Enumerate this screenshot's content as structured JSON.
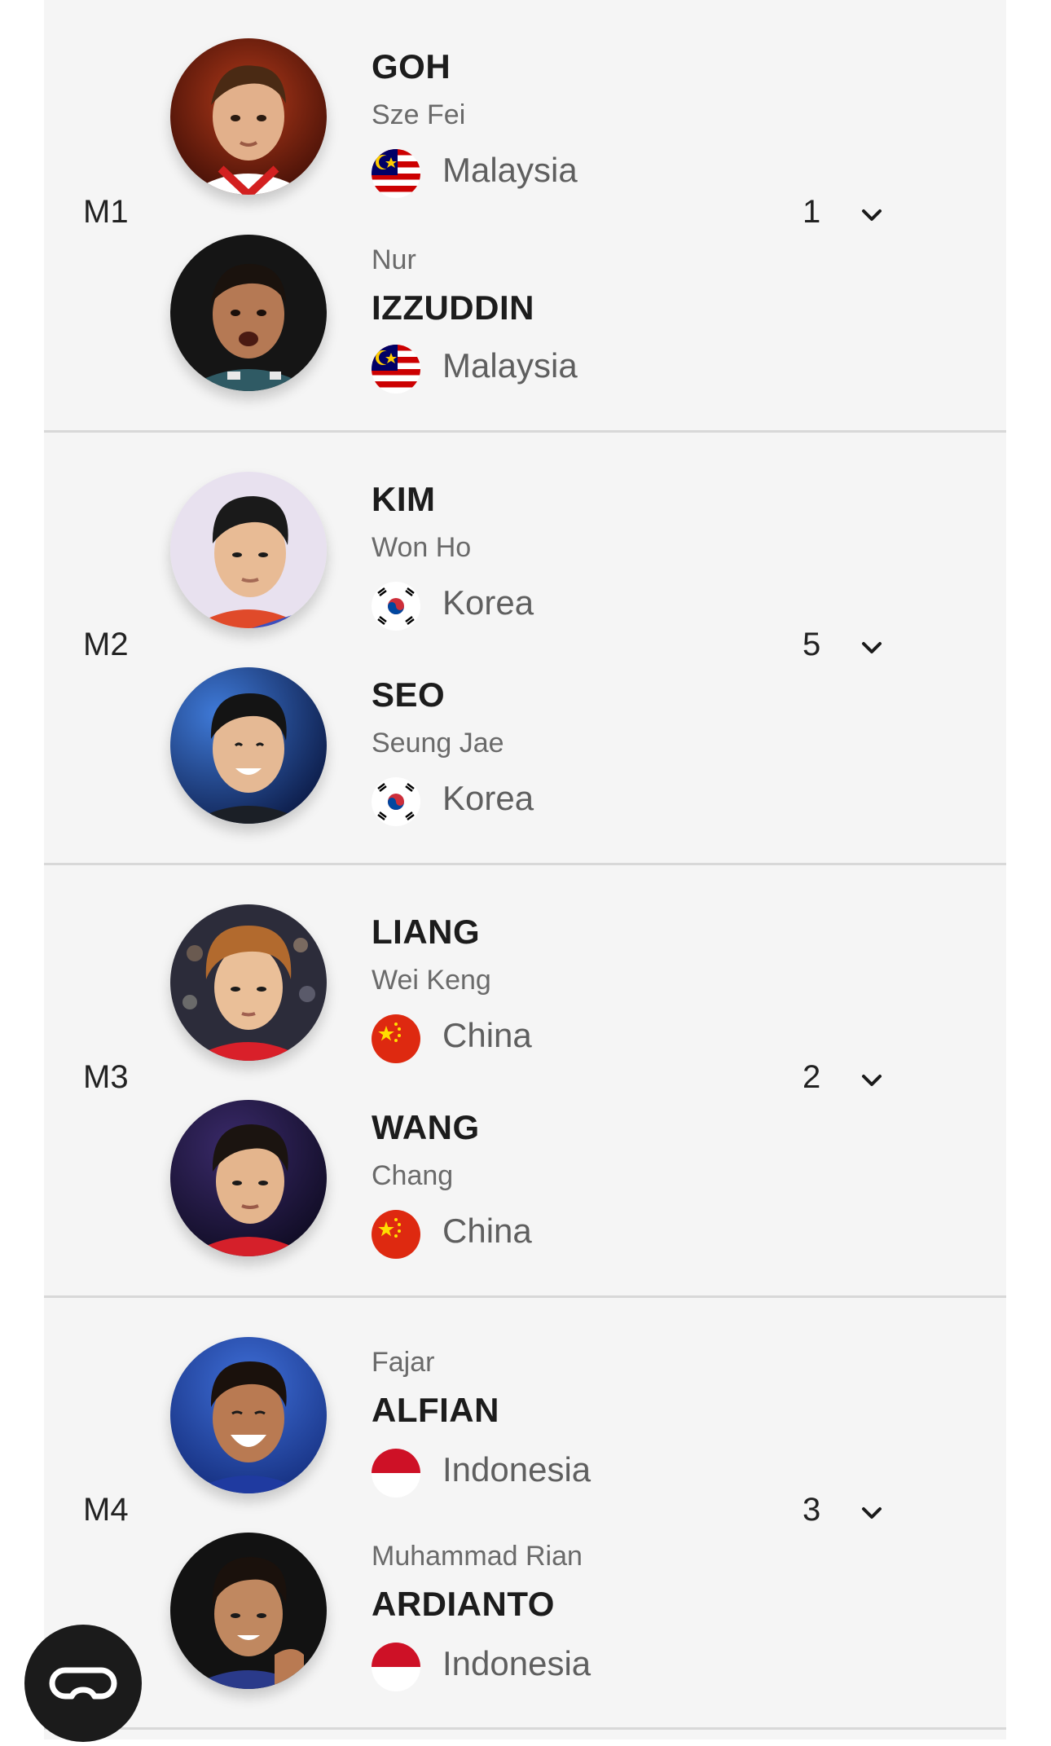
{
  "matches": [
    {
      "label": "M1",
      "score": "1",
      "players": [
        {
          "surname": "GOH",
          "given": "Sze Fei",
          "country": "Malaysia",
          "flag": "malaysia-flag-icon",
          "order": "surname-first"
        },
        {
          "surname": "IZZUDDIN",
          "given": "Nur",
          "country": "Malaysia",
          "flag": "malaysia-flag-icon",
          "order": "given-first"
        }
      ]
    },
    {
      "label": "M2",
      "score": "5",
      "players": [
        {
          "surname": "KIM",
          "given": "Won Ho",
          "country": "Korea",
          "flag": "korea-flag-icon",
          "order": "surname-first"
        },
        {
          "surname": "SEO",
          "given": "Seung Jae",
          "country": "Korea",
          "flag": "korea-flag-icon",
          "order": "surname-first"
        }
      ]
    },
    {
      "label": "M3",
      "score": "2",
      "players": [
        {
          "surname": "LIANG",
          "given": "Wei Keng",
          "country": "China",
          "flag": "china-flag-icon",
          "order": "surname-first"
        },
        {
          "surname": "WANG",
          "given": "Chang",
          "country": "China",
          "flag": "china-flag-icon",
          "order": "surname-first"
        }
      ]
    },
    {
      "label": "M4",
      "score": "3",
      "players": [
        {
          "surname": "ALFIAN",
          "given": "Fajar",
          "country": "Indonesia",
          "flag": "indonesia-flag-icon",
          "order": "given-first"
        },
        {
          "surname": "ARDIANTO",
          "given": "Muhammad Rian",
          "country": "Indonesia",
          "flag": "indonesia-flag-icon",
          "order": "given-first"
        }
      ]
    }
  ],
  "icons": {
    "expand": "chevron-down-icon",
    "fab": "eye-mask-icon"
  },
  "colors": {
    "panel": "#f5f5f5",
    "divider": "#d8d8d8",
    "text": "#1c1c1c",
    "muted": "#6a6a6a"
  }
}
